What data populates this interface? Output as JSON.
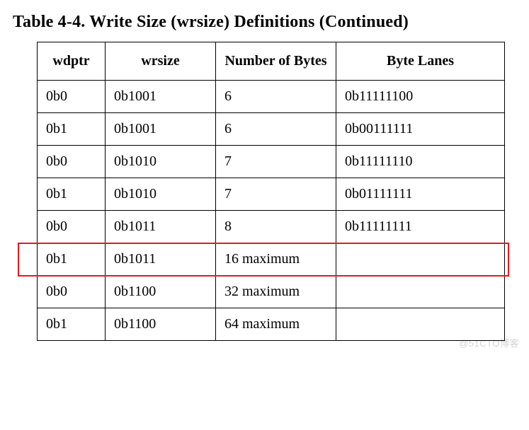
{
  "title": "Table 4-4. Write Size (wrsize) Definitions (Continued)",
  "columns": [
    "wdptr",
    "wrsize",
    "Number of Bytes",
    "Byte Lanes"
  ],
  "rows": [
    {
      "wdptr": "0b0",
      "wrsize": "0b1001",
      "nbytes": "6",
      "lanes": "0b11111100"
    },
    {
      "wdptr": "0b1",
      "wrsize": "0b1001",
      "nbytes": "6",
      "lanes": "0b00111111"
    },
    {
      "wdptr": "0b0",
      "wrsize": "0b1010",
      "nbytes": "7",
      "lanes": "0b11111110"
    },
    {
      "wdptr": "0b1",
      "wrsize": "0b1010",
      "nbytes": "7",
      "lanes": "0b01111111"
    },
    {
      "wdptr": "0b0",
      "wrsize": "0b1011",
      "nbytes": "8",
      "lanes": "0b11111111"
    },
    {
      "wdptr": "0b1",
      "wrsize": "0b1011",
      "nbytes": "16 maximum",
      "lanes": ""
    },
    {
      "wdptr": "0b0",
      "wrsize": "0b1100",
      "nbytes": "32 maximum",
      "lanes": ""
    },
    {
      "wdptr": "0b1",
      "wrsize": "0b1100",
      "nbytes": "64 maximum",
      "lanes": ""
    }
  ],
  "highlight_row_index": 5,
  "watermark": "@51CTO博客",
  "chart_data": {
    "type": "table",
    "title": "Table 4-4. Write Size (wrsize) Definitions (Continued)",
    "columns": [
      "wdptr",
      "wrsize",
      "Number of Bytes",
      "Byte Lanes"
    ],
    "rows": [
      [
        "0b0",
        "0b1001",
        "6",
        "0b11111100"
      ],
      [
        "0b1",
        "0b1001",
        "6",
        "0b00111111"
      ],
      [
        "0b0",
        "0b1010",
        "7",
        "0b11111110"
      ],
      [
        "0b1",
        "0b1010",
        "7",
        "0b01111111"
      ],
      [
        "0b0",
        "0b1011",
        "8",
        "0b11111111"
      ],
      [
        "0b1",
        "0b1011",
        "16 maximum",
        ""
      ],
      [
        "0b0",
        "0b1100",
        "32 maximum",
        ""
      ],
      [
        "0b1",
        "0b1100",
        "64 maximum",
        ""
      ]
    ],
    "highlighted_row": 5
  }
}
